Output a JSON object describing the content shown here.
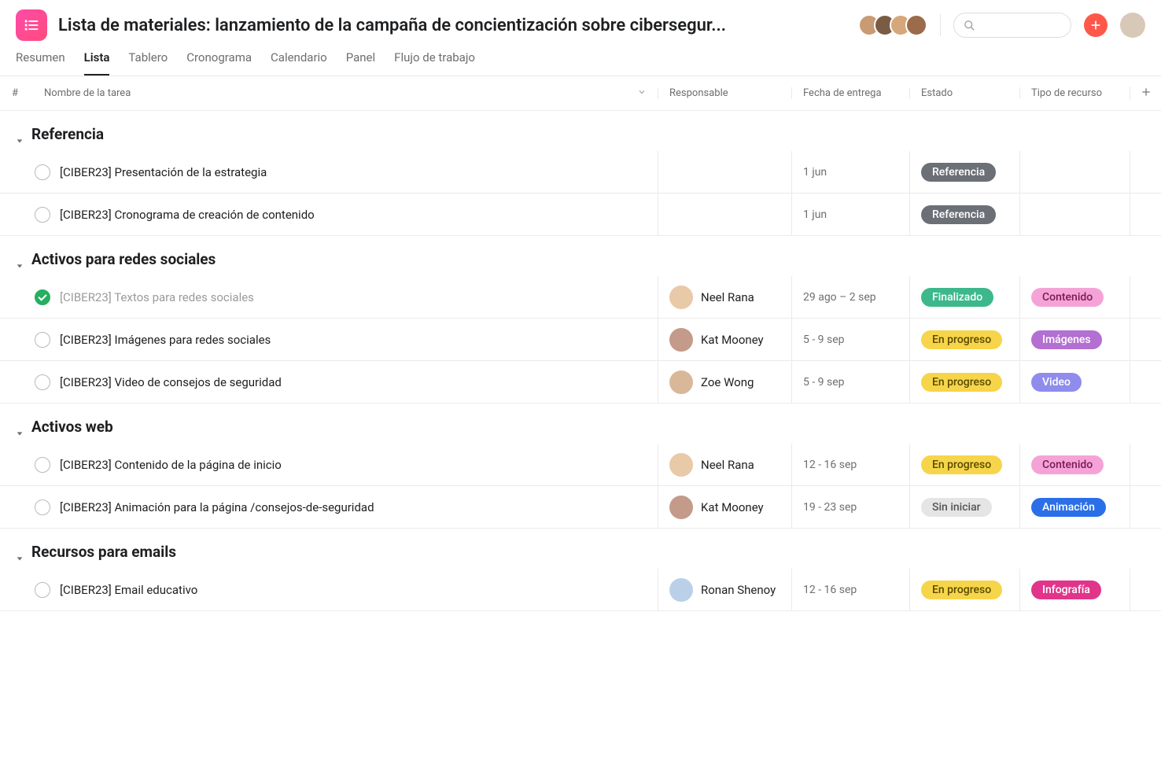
{
  "header": {
    "title": "Lista de materiales: lanzamiento de la campaña de concientización sobre cibersegur..."
  },
  "tabs": [
    {
      "label": "Resumen",
      "active": false
    },
    {
      "label": "Lista",
      "active": true
    },
    {
      "label": "Tablero",
      "active": false
    },
    {
      "label": "Cronograma",
      "active": false
    },
    {
      "label": "Calendario",
      "active": false
    },
    {
      "label": "Panel",
      "active": false
    },
    {
      "label": "Flujo de trabajo",
      "active": false
    }
  ],
  "columns": {
    "num": "#",
    "name": "Nombre de la tarea",
    "assignee": "Responsable",
    "date": "Fecha de entrega",
    "status": "Estado",
    "resource": "Tipo de recurso"
  },
  "sections": [
    {
      "title": "Referencia",
      "rows": [
        {
          "name": "[CIBER23] Presentación de la estrategia",
          "completed": false,
          "assignee": "",
          "date": "1 jun",
          "status": "Referencia",
          "status_class": "pill-referencia",
          "resource": "",
          "resource_class": ""
        },
        {
          "name": "[CIBER23] Cronograma de creación de contenido",
          "completed": false,
          "assignee": "",
          "date": "1 jun",
          "status": "Referencia",
          "status_class": "pill-referencia",
          "resource": "",
          "resource_class": ""
        }
      ]
    },
    {
      "title": "Activos para redes sociales",
      "rows": [
        {
          "name": "[CIBER23] Textos para redes sociales",
          "completed": true,
          "assignee": "Neel Rana",
          "avatar_class": "av-neel",
          "date": "29 ago – 2 sep",
          "status": "Finalizado",
          "status_class": "pill-finalizado",
          "resource": "Contenido",
          "resource_class": "pill-contenido"
        },
        {
          "name": "[CIBER23] Imágenes para redes sociales",
          "completed": false,
          "assignee": "Kat Mooney",
          "avatar_class": "av-kat",
          "date": "5 - 9 sep",
          "status": "En progreso",
          "status_class": "pill-enprogreso",
          "resource": "Imágenes",
          "resource_class": "pill-imagenes"
        },
        {
          "name": "[CIBER23] Video de consejos de seguridad",
          "completed": false,
          "assignee": "Zoe Wong",
          "avatar_class": "av-zoe",
          "date": "5 - 9 sep",
          "status": "En progreso",
          "status_class": "pill-enprogreso",
          "resource": "Video",
          "resource_class": "pill-video"
        }
      ]
    },
    {
      "title": "Activos web",
      "rows": [
        {
          "name": "[CIBER23] Contenido de la página de inicio",
          "completed": false,
          "assignee": "Neel Rana",
          "avatar_class": "av-neel",
          "date": "12 - 16 sep",
          "status": "En progreso",
          "status_class": "pill-enprogreso",
          "resource": "Contenido",
          "resource_class": "pill-contenido"
        },
        {
          "name": "[CIBER23] Animación para la página /consejos-de-seguridad",
          "completed": false,
          "assignee": "Kat Mooney",
          "avatar_class": "av-kat",
          "date": "19 - 23 sep",
          "status": "Sin iniciar",
          "status_class": "pill-siniciar",
          "resource": "Animación",
          "resource_class": "pill-animacion"
        }
      ]
    },
    {
      "title": "Recursos para emails",
      "rows": [
        {
          "name": "[CIBER23] Email educativo",
          "completed": false,
          "assignee": "Ronan Shenoy",
          "avatar_class": "av-ronan",
          "date": "12 - 16 sep",
          "status": "En progreso",
          "status_class": "pill-enprogreso",
          "resource": "Infografía",
          "resource_class": "pill-infografia"
        }
      ]
    }
  ]
}
